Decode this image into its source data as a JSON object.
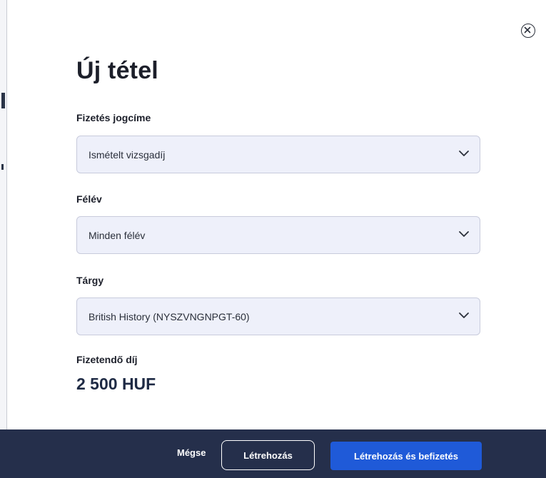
{
  "modal": {
    "title": "Új tétel"
  },
  "fields": {
    "payment_title": {
      "label": "Fizetés jogcíme",
      "value": "Ismételt vizsgadíj"
    },
    "semester": {
      "label": "Félév",
      "value": "Minden félév"
    },
    "subject": {
      "label": "Tárgy",
      "value": "British History (NYSZVNGNPGT-60)"
    }
  },
  "fee": {
    "label": "Fizetendő díj",
    "value": "2 500 HUF"
  },
  "footer": {
    "cancel_label": "Mégse",
    "create_label": "Létrehozás",
    "create_pay_label": "Létrehozás és befizetés"
  },
  "colors": {
    "footer_bg": "#252f4b",
    "primary_button": "#1f5ad8",
    "select_bg": "#eef0fa"
  }
}
